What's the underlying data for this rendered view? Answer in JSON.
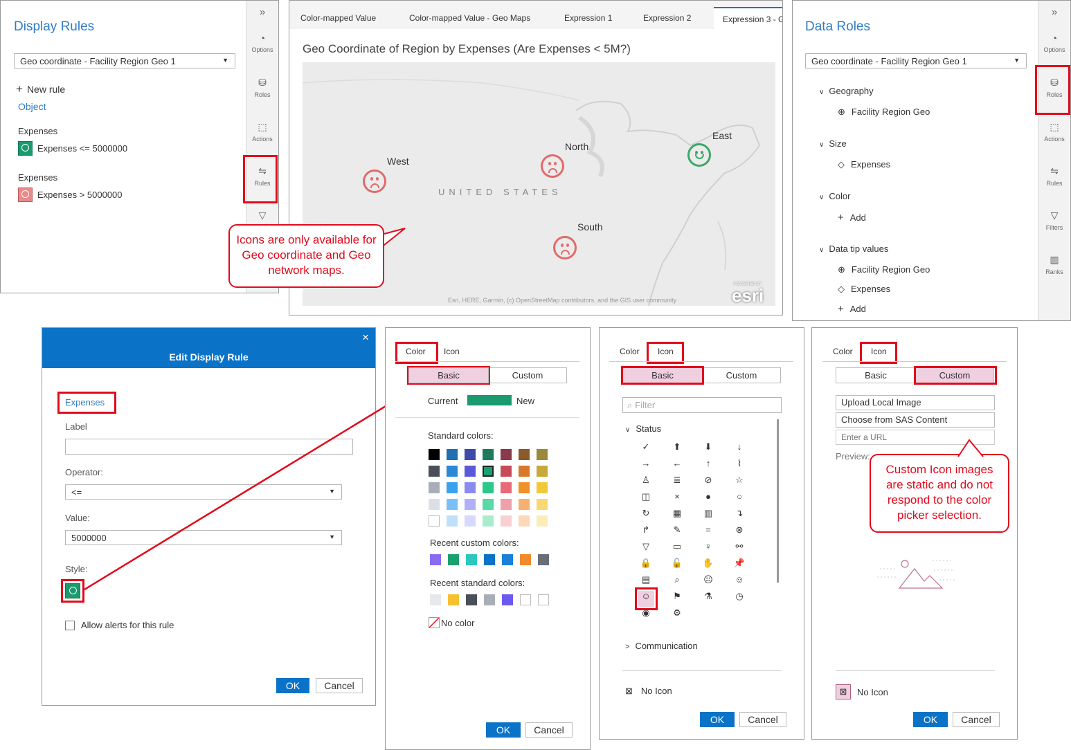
{
  "display_rules": {
    "title": "Display Rules",
    "dropdown": "Geo coordinate - Facility Region Geo 1",
    "new_rule": "New rule",
    "object": "Object",
    "rule1_field": "Expenses",
    "rule1_text": "Expenses <= 5000000",
    "rule2_field": "Expenses",
    "rule2_text": "Expenses > 5000000"
  },
  "left_sidebar": {
    "expand": "»",
    "options": "Options",
    "roles": "Roles",
    "actions": "Actions",
    "rules": "Rules"
  },
  "report": {
    "tabs": [
      "Color-mapped Value",
      "Color-mapped Value - Geo Maps",
      "Expression 1",
      "Expression 2",
      "Expression 3 - G"
    ],
    "map_title": "Geo Coordinate of Region by Expenses (Are Expenses < 5M?)",
    "country": "UNITED STATES",
    "regions": {
      "west": "West",
      "north": "North",
      "east": "East",
      "south": "South"
    },
    "attribution": "Esri, HERE, Garmin, (c) OpenStreetMap contributors, and the GIS user community",
    "esri_powered": "POWERED BY",
    "esri": "esri"
  },
  "callout1": "Icons are only available for Geo coordinate and Geo network maps.",
  "data_roles": {
    "title": "Data Roles",
    "dropdown": "Geo coordinate - Facility Region Geo 1",
    "geography": "Geography",
    "geography_item": "Facility Region Geo",
    "size": "Size",
    "size_item": "Expenses",
    "color": "Color",
    "color_add": "Add",
    "data_tip": "Data tip values",
    "tip1": "Facility Region Geo",
    "tip2": "Expenses",
    "tip_add": "Add"
  },
  "right_sidebar": {
    "expand": "»",
    "options": "Options",
    "roles": "Roles",
    "actions": "Actions",
    "rules": "Rules",
    "filters": "Filters",
    "ranks": "Ranks"
  },
  "edit_rule": {
    "title": "Edit Display Rule",
    "close": "×",
    "field": "Expenses",
    "label_lbl": "Label",
    "label_val": "",
    "operator_lbl": "Operator:",
    "operator_val": "<=",
    "value_lbl": "Value:",
    "value_val": "5000000",
    "style_lbl": "Style:",
    "alerts": "Allow alerts for this rule",
    "ok": "OK",
    "cancel": "Cancel"
  },
  "color_picker": {
    "tab_color": "Color",
    "tab_icon": "Icon",
    "basic": "Basic",
    "custom": "Custom",
    "current": "Current",
    "new": "New",
    "standard": "Standard colors:",
    "recent_custom": "Recent custom colors:",
    "recent_standard": "Recent standard colors:",
    "no_color": "No color",
    "ok": "OK",
    "cancel": "Cancel",
    "standard_rows": [
      [
        "#000000",
        "#1f6fb2",
        "#3d4aa8",
        "#1f7a5c",
        "#8a3a4a",
        "#8a5a2a",
        "#9a8a3a"
      ],
      [
        "#4a4e58",
        "#2a88d8",
        "#5a5ad8",
        "#1aa070",
        "#c84a5a",
        "#d8782a",
        "#c8a83a"
      ],
      [
        "#a8aeb8",
        "#3aa0f0",
        "#8a8af0",
        "#2ac88a",
        "#e86a78",
        "#f0902a",
        "#f0c83a"
      ],
      [
        "#dce0e6",
        "#7ac0f8",
        "#b0b0f8",
        "#5ad8a8",
        "#f0a0a8",
        "#f8b070",
        "#f8d870"
      ],
      [
        "#ffffff",
        "#c0e0fa",
        "#d8d8fc",
        "#a8ecd0",
        "#f8d0d4",
        "#fcd8b8",
        "#fcecb8"
      ]
    ],
    "recent_custom_colors": [
      "#8a6af0",
      "#1aa070",
      "#2ac8c0",
      "#0a73c8",
      "#1a80d8",
      "#f08a2a",
      "#6a6e78"
    ],
    "recent_standard_colors": [
      "#e6e8ec",
      "#f8c030",
      "#4a4e58",
      "#a8aeb8",
      "#6a5af0",
      "#ffffff",
      "#ffffff"
    ],
    "current_color": "#1a9a6e"
  },
  "icon_picker": {
    "tab_color": "Color",
    "tab_icon": "Icon",
    "basic": "Basic",
    "custom": "Custom",
    "filter_placeholder": "Filter",
    "status": "Status",
    "communication": "Communication",
    "no_icon": "No Icon",
    "ok": "OK",
    "cancel": "Cancel",
    "glyphs": [
      "✓",
      "⬆",
      "⬇",
      "↓",
      "→",
      "←",
      "↑",
      "⌇",
      "♙",
      "≣",
      "⊘",
      "☆",
      "◫",
      "×",
      "●",
      "○",
      "↻",
      "▦",
      "▥",
      "↴",
      "↱",
      "✎",
      "=",
      "⊗",
      "▽",
      "▭",
      "♀",
      "⚯",
      "🔒",
      "🔓",
      "✋",
      "📌",
      "▤",
      "⌕",
      "☹",
      "☺",
      "☺",
      "⚑",
      "⚗",
      "◷",
      "◉",
      "⚙"
    ]
  },
  "custom_icon": {
    "tab_color": "Color",
    "tab_icon": "Icon",
    "basic": "Basic",
    "custom": "Custom",
    "upload": "Upload Local Image",
    "choose": "Choose from SAS Content",
    "url_placeholder": "Enter a URL",
    "preview": "Preview:",
    "no_icon": "No Icon",
    "ok": "OK",
    "cancel": "Cancel"
  },
  "callout2": "Custom Icon images are static and do not respond to the color picker selection.",
  "colors": {
    "accent": "#2f7dc4",
    "highlight": "#e2091b",
    "selected_segment": "#f0cfe0",
    "ok_button": "#0a73c8",
    "happy": "#3aa868",
    "sad": "#e36a6a",
    "dialog_header": "#0a73c8"
  }
}
